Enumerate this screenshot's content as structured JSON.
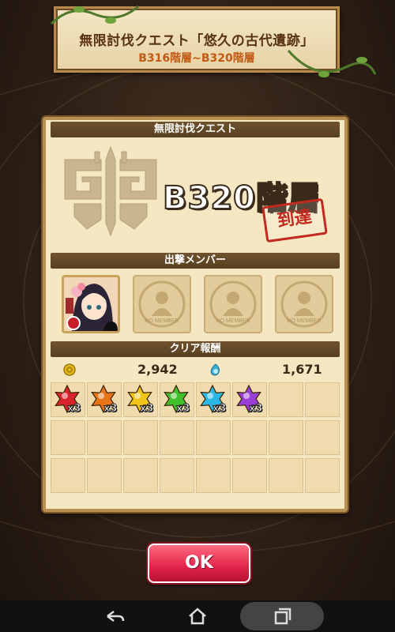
{
  "banner": {
    "title": "無限討伐クエスト「悠久の古代遺跡」",
    "subtitle": "B316階層~B320階層"
  },
  "quest": {
    "section_title": "無限討伐クエスト",
    "floor": "B320階層",
    "stamp": "到達"
  },
  "members": {
    "section_title": "出撃メンバー",
    "slots": [
      {
        "filled": true,
        "label": ""
      },
      {
        "filled": false,
        "label": "NO MEMBER"
      },
      {
        "filled": false,
        "label": "NO MEMBER"
      },
      {
        "filled": false,
        "label": "NO MEMBER"
      }
    ]
  },
  "rewards": {
    "section_title": "クリア報酬",
    "gold": "2,942",
    "exp": "1,671",
    "items": [
      {
        "color": "#d8232a",
        "count": "x3"
      },
      {
        "color": "#e8741a",
        "count": "x3"
      },
      {
        "color": "#f0c419",
        "count": "x3"
      },
      {
        "color": "#3fbf2a",
        "count": "x3"
      },
      {
        "color": "#2bb7e6",
        "count": "x3"
      },
      {
        "color": "#9a3fd6",
        "count": "x3"
      }
    ]
  },
  "ok_label": "OK"
}
